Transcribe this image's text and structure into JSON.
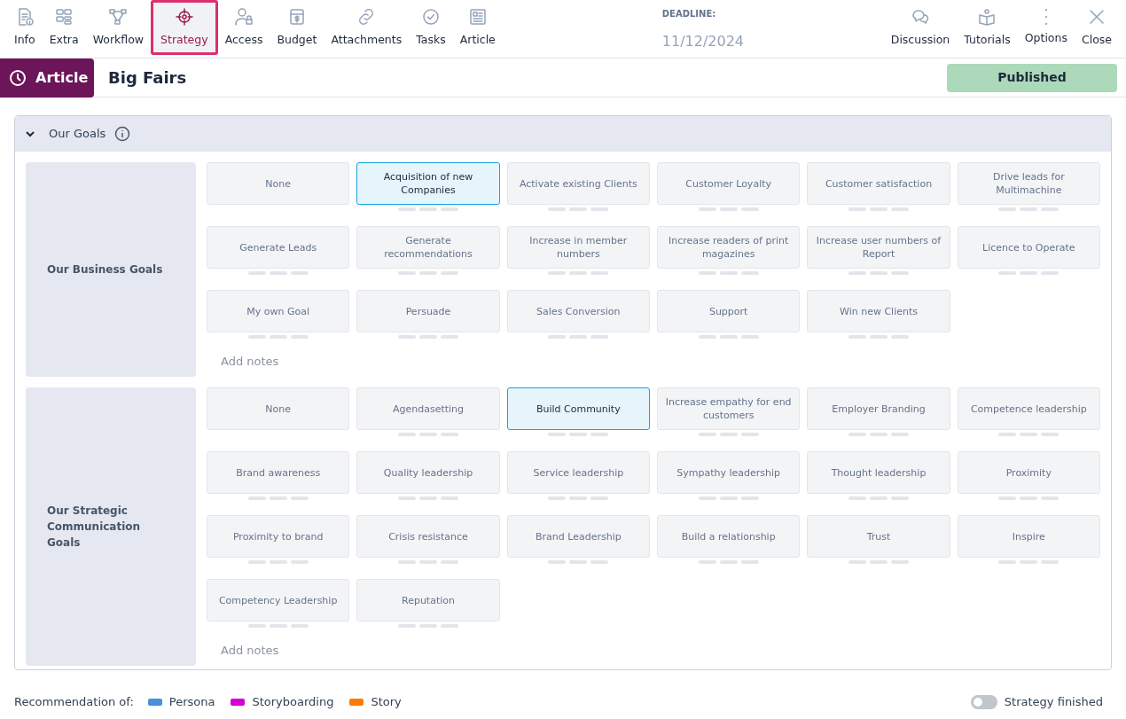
{
  "toolbar": {
    "tabs": [
      {
        "label": "Info",
        "kind": "info",
        "selected": false
      },
      {
        "label": "Extra",
        "kind": "extra",
        "selected": false
      },
      {
        "label": "Workflow",
        "kind": "workflow",
        "selected": false
      },
      {
        "label": "Strategy",
        "kind": "target",
        "selected": true
      },
      {
        "label": "Access",
        "kind": "access",
        "selected": false
      },
      {
        "label": "Budget",
        "kind": "budget",
        "selected": false
      },
      {
        "label": "Attachments",
        "kind": "link",
        "selected": false
      },
      {
        "label": "Tasks",
        "kind": "check",
        "selected": false
      },
      {
        "label": "Article",
        "kind": "article",
        "selected": false
      }
    ],
    "deadline": {
      "label": "DEADLINE:",
      "value": "11/12/2024"
    },
    "actions": [
      {
        "label": "Discussion",
        "kind": "chat"
      },
      {
        "label": "Tutorials",
        "kind": "book"
      },
      {
        "label": "Options",
        "kind": "dots"
      },
      {
        "label": "Close",
        "kind": "close"
      }
    ]
  },
  "header": {
    "badge": "Article",
    "title": "Big Fairs",
    "status": "Published"
  },
  "panel": {
    "title": "Our Goals",
    "expanded": true,
    "groups": [
      {
        "label": "Our Business Goals",
        "notes_placeholder": "Add notes",
        "tiles": [
          {
            "label": "None",
            "kind": "none",
            "selected": false
          },
          {
            "label": "Acquisition of new Companies",
            "kind": "goal",
            "selected": true
          },
          {
            "label": "Activate existing Clients",
            "kind": "goal",
            "selected": false
          },
          {
            "label": "Customer Loyalty",
            "kind": "goal",
            "selected": false
          },
          {
            "label": "Customer satisfaction",
            "kind": "goal",
            "selected": false
          },
          {
            "label": "Drive leads for Multimachine",
            "kind": "goal",
            "selected": false
          },
          {
            "label": "Generate Leads",
            "kind": "goal",
            "selected": false
          },
          {
            "label": "Generate recommendations",
            "kind": "goal",
            "selected": false
          },
          {
            "label": "Increase in member numbers",
            "kind": "goal",
            "selected": false
          },
          {
            "label": "Increase readers of print magazines",
            "kind": "goal",
            "selected": false
          },
          {
            "label": "Increase user numbers of Report",
            "kind": "goal",
            "selected": false
          },
          {
            "label": "Licence to Operate",
            "kind": "goal",
            "selected": false
          },
          {
            "label": "My own Goal",
            "kind": "goal",
            "selected": false
          },
          {
            "label": "Persuade",
            "kind": "goal",
            "selected": false
          },
          {
            "label": "Sales Conversion",
            "kind": "goal",
            "selected": false
          },
          {
            "label": "Support",
            "kind": "goal",
            "selected": false
          },
          {
            "label": "Win new Clients",
            "kind": "goal",
            "selected": false
          }
        ]
      },
      {
        "label": "Our Strategic Communication Goals",
        "notes_placeholder": "Add notes",
        "tiles": [
          {
            "label": "None",
            "kind": "none",
            "selected": false
          },
          {
            "label": "Agendasetting",
            "kind": "goal",
            "selected": false
          },
          {
            "label": "Build Community",
            "kind": "goal",
            "selected": true
          },
          {
            "label": "Increase empathy for end customers",
            "kind": "goal",
            "selected": false
          },
          {
            "label": "Employer Branding",
            "kind": "goal",
            "selected": false
          },
          {
            "label": "Competence leadership",
            "kind": "goal",
            "selected": false
          },
          {
            "label": "Brand awareness",
            "kind": "goal",
            "selected": false
          },
          {
            "label": "Quality leadership",
            "kind": "goal",
            "selected": false
          },
          {
            "label": "Service leadership",
            "kind": "goal",
            "selected": false
          },
          {
            "label": "Sympathy leadership",
            "kind": "goal",
            "selected": false
          },
          {
            "label": "Thought leadership",
            "kind": "goal",
            "selected": false
          },
          {
            "label": "Proximity",
            "kind": "goal",
            "selected": false
          },
          {
            "label": "Proximity to brand",
            "kind": "goal",
            "selected": false
          },
          {
            "label": "Crisis resistance",
            "kind": "goal",
            "selected": false
          },
          {
            "label": "Brand Leadership",
            "kind": "goal",
            "selected": false
          },
          {
            "label": "Build a relationship",
            "kind": "goal",
            "selected": false
          },
          {
            "label": "Trust",
            "kind": "goal",
            "selected": false
          },
          {
            "label": "Inspire",
            "kind": "goal",
            "selected": false
          },
          {
            "label": "Competency Leadership",
            "kind": "goal",
            "selected": false
          },
          {
            "label": "Reputation",
            "kind": "goal",
            "selected": false
          }
        ]
      }
    ]
  },
  "footer": {
    "legend_label": "Recommendation of:",
    "legend": [
      {
        "label": "Persona",
        "color": "#4a90d9"
      },
      {
        "label": "Storyboarding",
        "color": "#d400d4"
      },
      {
        "label": "Story",
        "color": "#ff7a00"
      }
    ],
    "toggle": {
      "label": "Strategy finished",
      "on": false
    }
  }
}
